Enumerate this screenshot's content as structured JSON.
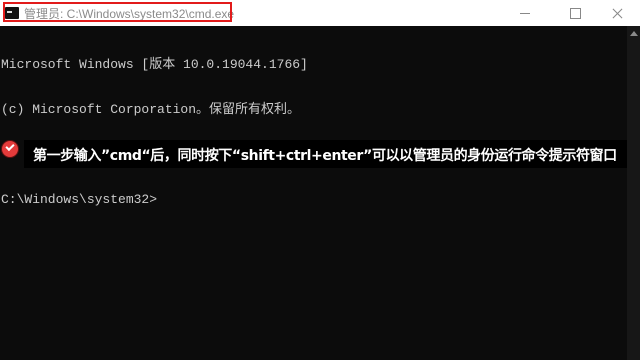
{
  "window": {
    "title": "管理员: C:\\Windows\\system32\\cmd.exe",
    "app_icon": "cmd-icon",
    "controls": {
      "minimize_icon": "minimize-icon",
      "maximize_icon": "maximize-icon",
      "close_icon": "close-icon"
    }
  },
  "console": {
    "lines": [
      "Microsoft Windows [版本 10.0.19044.1766]",
      "(c) Microsoft Corporation。保留所有权利。",
      "",
      "C:\\Windows\\system32>"
    ]
  },
  "annotation": {
    "icon": "red-check-icon",
    "text": "第一步输入”cmd“后，同时按下“shift+ctrl+enter”可以以管理员的身份运行命令提示符窗口",
    "highlight_color": "#e21b1b"
  }
}
